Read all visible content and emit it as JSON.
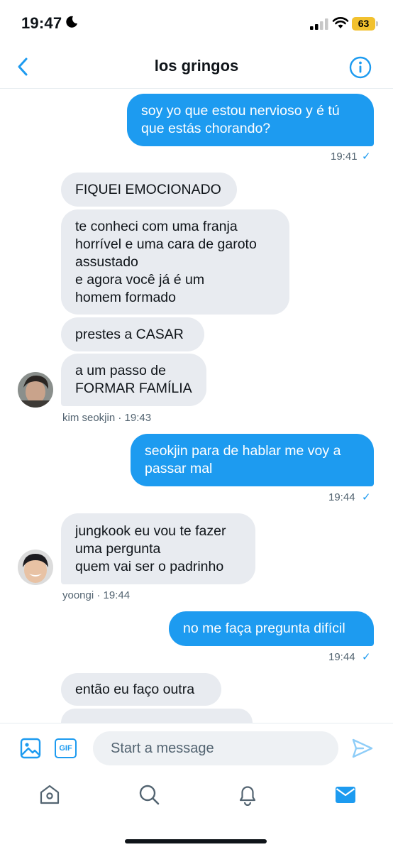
{
  "status_bar": {
    "time": "19:47",
    "battery": "63",
    "battery_color": "#f2c12e"
  },
  "header": {
    "title": "los gringos",
    "accent_color": "#1d9bf0"
  },
  "messages": [
    {
      "dir": "out",
      "text": "soy yo que estou nervioso y é tú\nque estás chorando?"
    },
    {
      "dir": "meta_out",
      "time": "19:41",
      "read": "✓"
    },
    {
      "dir": "in",
      "text": "FIQUEI EMOCIONADO"
    },
    {
      "dir": "in",
      "text": "te conheci com uma franja\nhorrível e uma cara de garoto\nassustado\ne agora você já é um\nhomem formado"
    },
    {
      "dir": "in",
      "text": "prestes a CASAR"
    },
    {
      "dir": "in",
      "text": "a um passo de\nFORMAR FAMÍLIA"
    },
    {
      "dir": "meta_in",
      "sender": "kim seokjin · 19:43"
    },
    {
      "dir": "out",
      "text": "seokjin para de hablar me voy a\npassar mal"
    },
    {
      "dir": "meta_out",
      "time": "19:44",
      "read": "✓"
    },
    {
      "dir": "in",
      "text": "jungkook eu vou te fazer\numa pergunta\nquem vai ser o padrinho"
    },
    {
      "dir": "meta_in",
      "sender": "yoongi · 19:44"
    },
    {
      "dir": "out",
      "text": "no me faça pregunta difícil"
    },
    {
      "dir": "meta_out",
      "time": "19:44",
      "read": "✓"
    },
    {
      "dir": "in",
      "text": "então eu faço outra"
    }
  ],
  "composer": {
    "placeholder": "Start a message",
    "gif_label": "GIF"
  },
  "tab_bar": {
    "icons": [
      "home-icon",
      "search-icon",
      "notifications-icon",
      "messages-icon"
    ]
  }
}
